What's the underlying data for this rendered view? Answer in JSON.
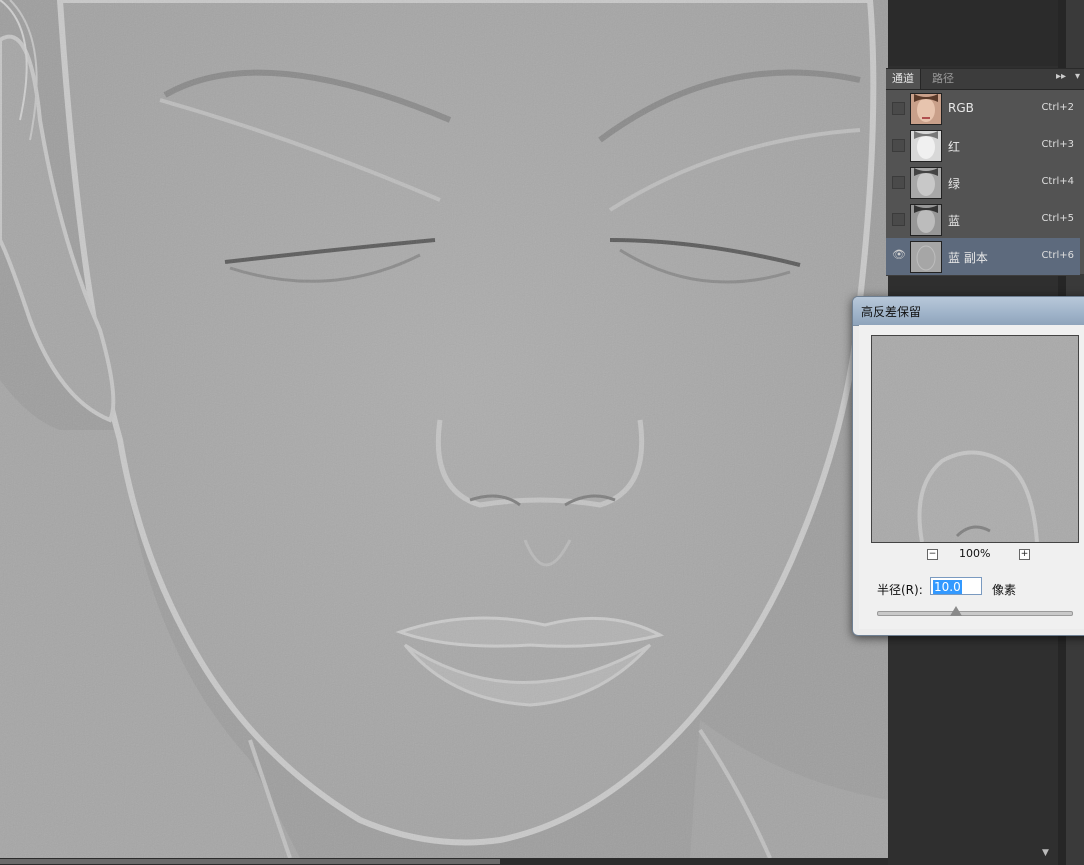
{
  "channels_panel": {
    "tabs": [
      {
        "label": "通道"
      },
      {
        "label": "路径"
      }
    ],
    "menu_icon": "panel-menu-icon",
    "channels": [
      {
        "name": "RGB",
        "shortcut": "Ctrl+2",
        "visible": false,
        "selected": false
      },
      {
        "name": "红",
        "shortcut": "Ctrl+3",
        "visible": false,
        "selected": false
      },
      {
        "name": "绿",
        "shortcut": "Ctrl+4",
        "visible": false,
        "selected": false
      },
      {
        "name": "蓝",
        "shortcut": "Ctrl+5",
        "visible": false,
        "selected": false
      },
      {
        "name": "蓝 副本",
        "shortcut": "Ctrl+6",
        "visible": true,
        "selected": true
      }
    ]
  },
  "dialog": {
    "title": "高反差保留",
    "zoom_level": "100%",
    "radius_label": "半径(R):",
    "radius_value": "10.0",
    "radius_unit": "像素",
    "slider_level": 0.4
  },
  "colors": {
    "selected_row": "#5d6a7d",
    "panel_bg": "#535353",
    "dialog_title": "#9fb3c9"
  }
}
